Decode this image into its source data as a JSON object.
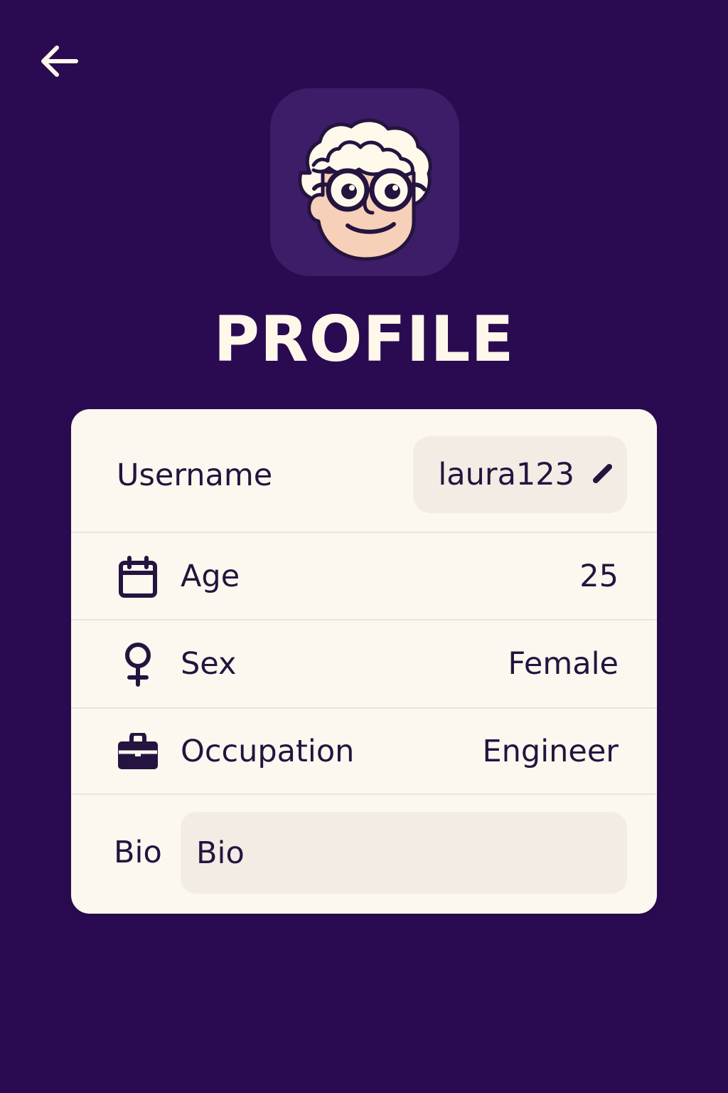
{
  "header": {
    "title": "PROFILE",
    "back_icon": "arrow-left-icon"
  },
  "avatar": {
    "icon": "avatar-icon"
  },
  "profile": {
    "username": {
      "label": "Username",
      "value": "laura123",
      "edit_icon": "pencil-icon"
    },
    "age": {
      "label": "Age",
      "value": "25",
      "icon": "calendar-icon"
    },
    "sex": {
      "label": "Sex",
      "value": "Female",
      "icon": "female-symbol-icon"
    },
    "occupation": {
      "label": "Occupation",
      "value": "Engineer",
      "icon": "briefcase-icon"
    },
    "bio": {
      "label": "Bio",
      "placeholder": "Bio",
      "value": ""
    }
  },
  "colors": {
    "background": "#2a0b52",
    "card": "#fcf8ef",
    "accent": "#24143f",
    "field": "#f3ece5",
    "title": "#fff7ea"
  }
}
